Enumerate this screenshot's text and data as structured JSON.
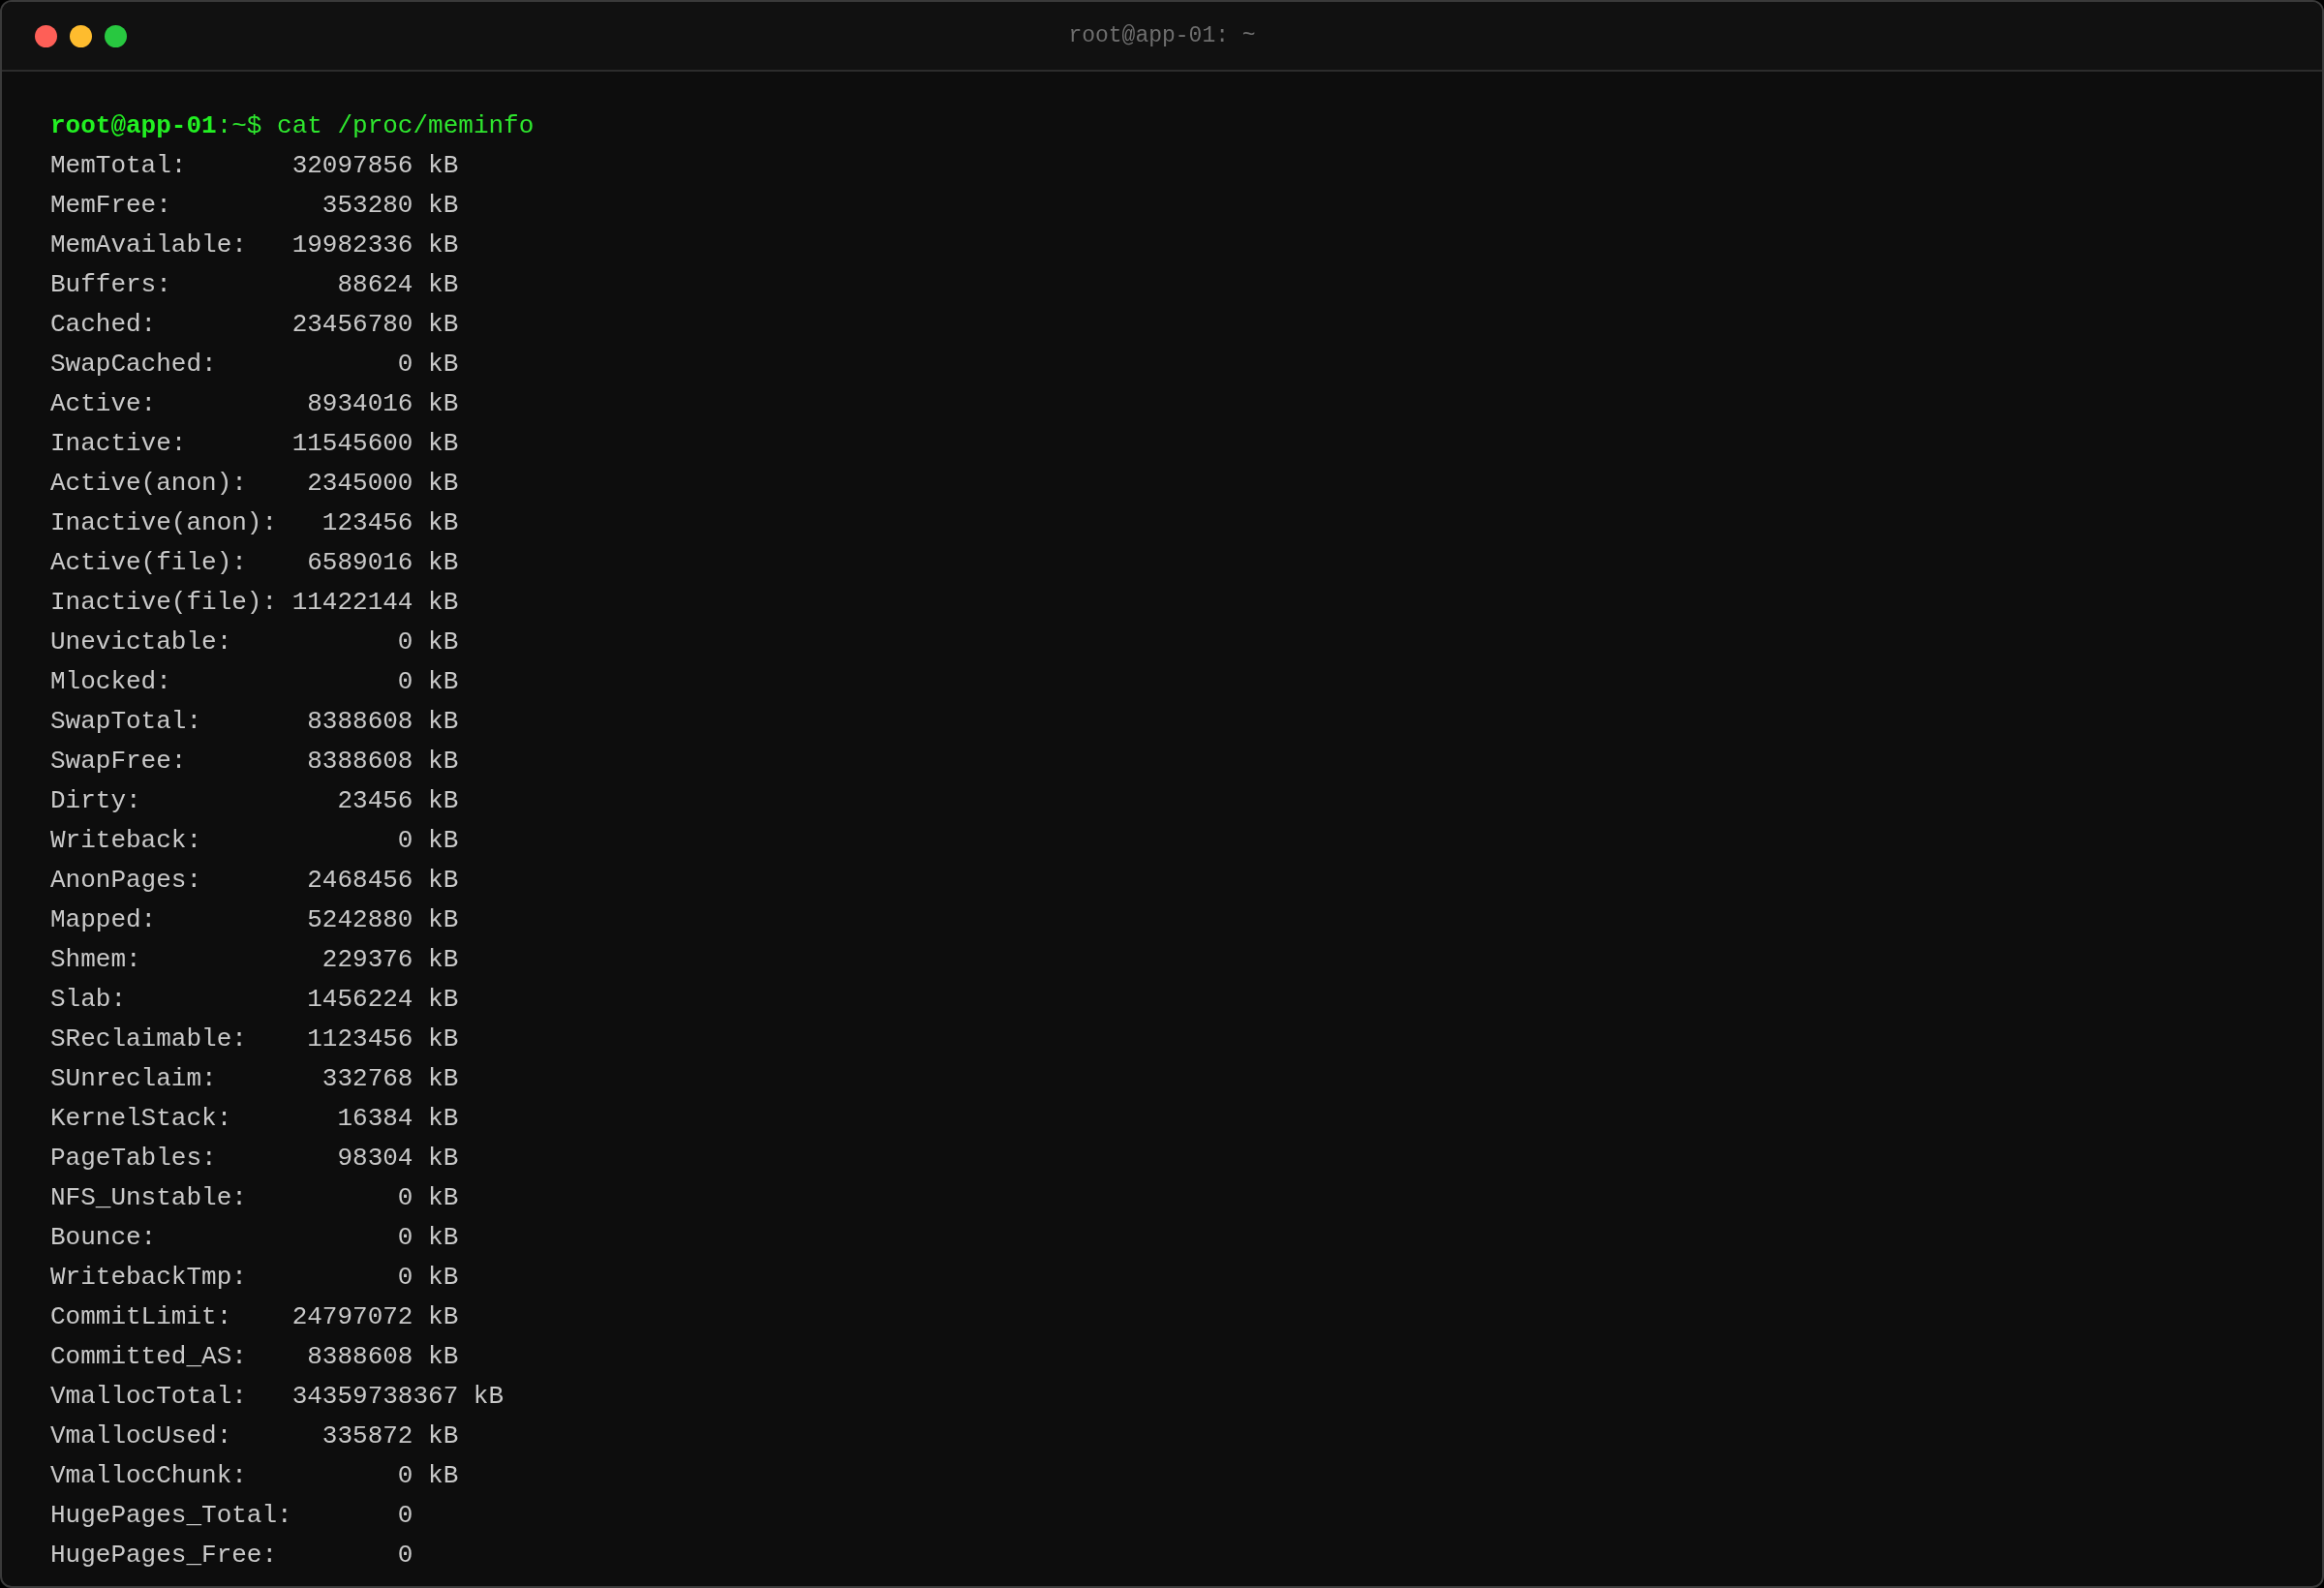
{
  "window": {
    "title": "root@app-01: ~"
  },
  "prompt": "**root@app-01**:~$ cat /proc/meminfo",
  "lines": [
    {
      "label": "MemTotal:",
      "value": "32097856",
      "unit": "kB"
    },
    {
      "label": "MemFree:",
      "value": "353280",
      "unit": "kB"
    },
    {
      "label": "MemAvailable:",
      "value": "19982336",
      "unit": "kB"
    },
    {
      "label": "Buffers:",
      "value": "88624",
      "unit": "kB"
    },
    {
      "label": "Cached:",
      "value": "23456780",
      "unit": "kB"
    },
    {
      "label": "SwapCached:",
      "value": "0",
      "unit": "kB"
    },
    {
      "label": "Active:",
      "value": "8934016",
      "unit": "kB"
    },
    {
      "label": "Inactive:",
      "value": "11545600",
      "unit": "kB"
    },
    {
      "label": "Active(anon):",
      "value": "2345000",
      "unit": "kB"
    },
    {
      "label": "Inactive(anon):",
      "value": "123456",
      "unit": "kB"
    },
    {
      "label": "Active(file):",
      "value": "6589016",
      "unit": "kB"
    },
    {
      "label": "Inactive(file):",
      "value": "11422144",
      "unit": "kB"
    },
    {
      "label": "Unevictable:",
      "value": "0",
      "unit": "kB"
    },
    {
      "label": "Mlocked:",
      "value": "0",
      "unit": "kB"
    },
    {
      "label": "SwapTotal:",
      "value": "8388608",
      "unit": "kB"
    },
    {
      "label": "SwapFree:",
      "value": "8388608",
      "unit": "kB"
    },
    {
      "label": "Dirty:",
      "value": "23456",
      "unit": "kB"
    },
    {
      "label": "Writeback:",
      "value": "0",
      "unit": "kB"
    },
    {
      "label": "AnonPages:",
      "value": "2468456",
      "unit": "kB"
    },
    {
      "label": "Mapped:",
      "value": "5242880",
      "unit": "kB"
    },
    {
      "label": "Shmem:",
      "value": "229376",
      "unit": "kB"
    },
    {
      "label": "Slab:",
      "value": "1456224",
      "unit": "kB"
    },
    {
      "label": "SReclaimable:",
      "value": "1123456",
      "unit": "kB"
    },
    {
      "label": "SUnreclaim:",
      "value": "332768",
      "unit": "kB"
    },
    {
      "label": "KernelStack:",
      "value": "16384",
      "unit": "kB"
    },
    {
      "label": "PageTables:",
      "value": "98304",
      "unit": "kB"
    },
    {
      "label": "NFS_Unstable:",
      "value": "0",
      "unit": "kB"
    },
    {
      "label": "Bounce:",
      "value": "0",
      "unit": "kB"
    },
    {
      "label": "WritebackTmp:",
      "value": "0",
      "unit": "kB"
    },
    {
      "label": "CommitLimit:",
      "value": "24797072",
      "unit": "kB"
    },
    {
      "label": "Committed_AS:",
      "value": "8388608",
      "unit": "kB"
    },
    {
      "label": "VmallocTotal:",
      "value": "34359738367",
      "unit": "kB"
    },
    {
      "label": "VmallocUsed:",
      "value": "335872",
      "unit": "kB"
    },
    {
      "label": "VmallocChunk:",
      "value": "0",
      "unit": "kB"
    },
    {
      "label": "HugePages_Total:",
      "value": "0"
    },
    {
      "label": "HugePages_Free:",
      "value": "0"
    }
  ]
}
